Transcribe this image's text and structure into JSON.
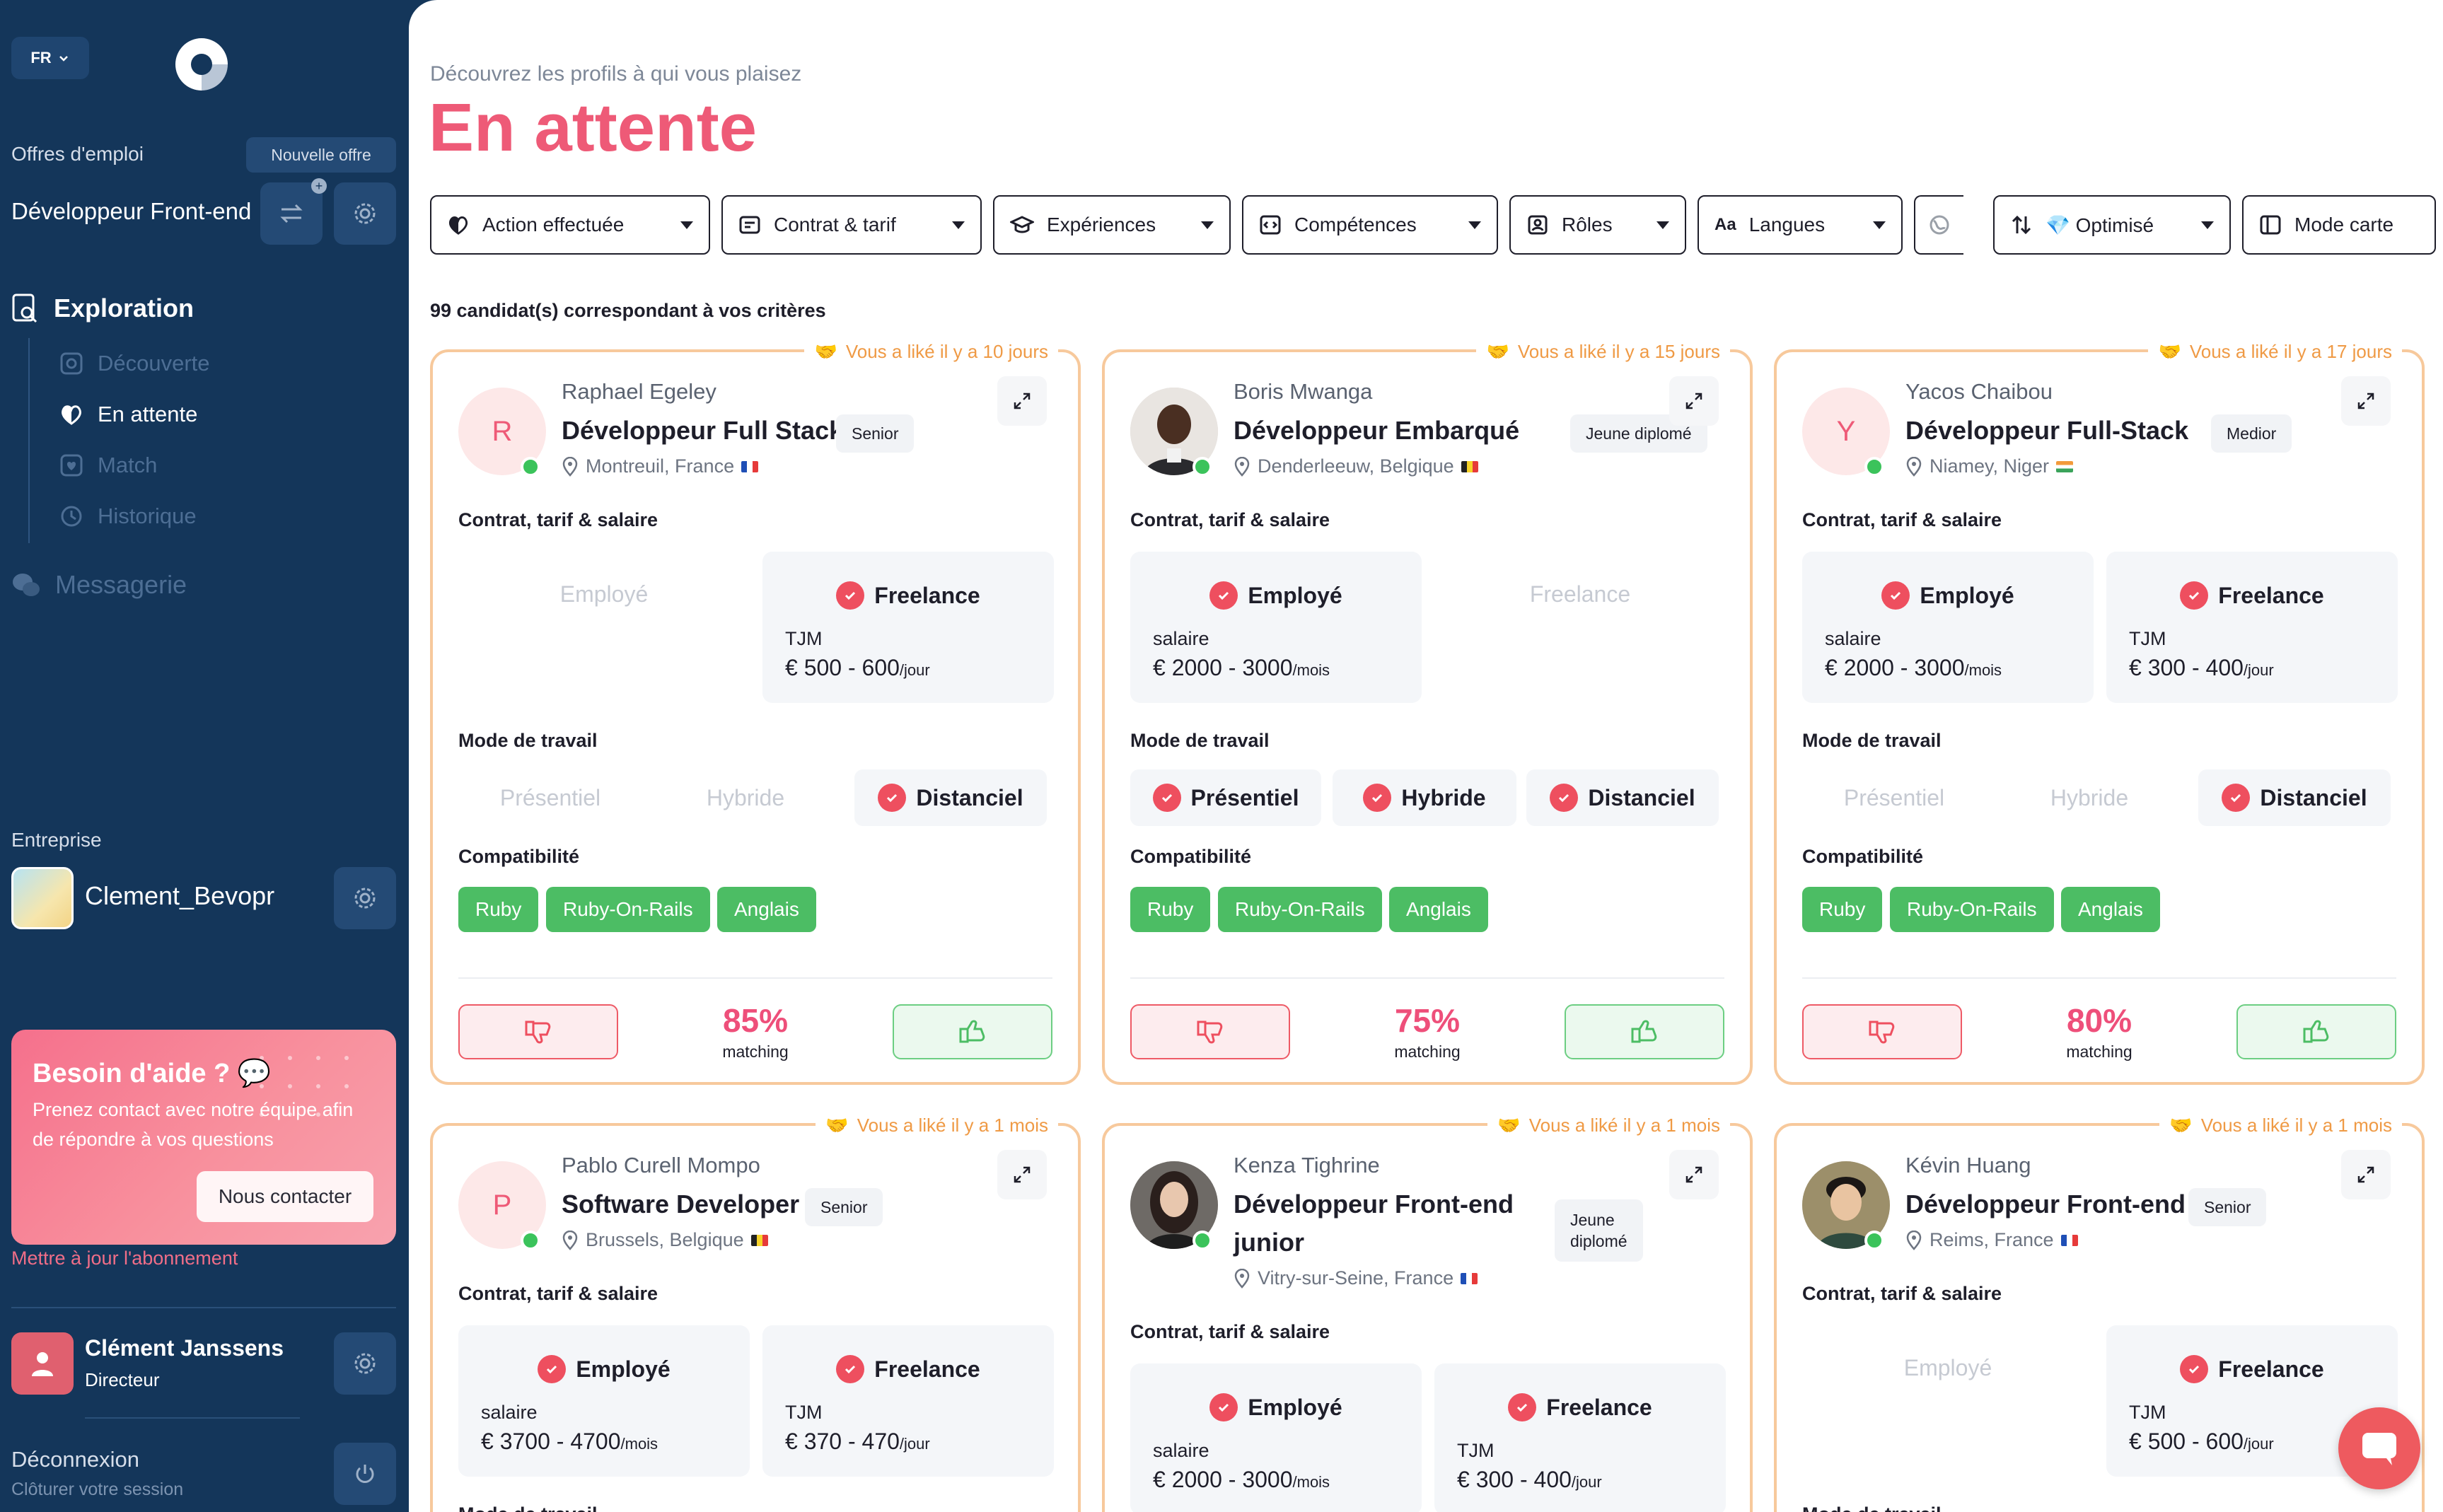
{
  "sidebar": {
    "lang": "FR",
    "job_offers_label": "Offres d'emploi",
    "new_offer": "Nouvelle offre",
    "current_job": "Développeur Front-end",
    "nav": {
      "exploration": "Exploration",
      "decouverte": "Découverte",
      "en_attente": "En attente",
      "match": "Match",
      "historique": "Historique",
      "messagerie": "Messagerie"
    },
    "company_label": "Entreprise",
    "company_name": "Clement_Bevopr",
    "help": {
      "title": "Besoin d'aide ? 💬",
      "text": "Prenez contact avec notre équipe afin de répondre à vos questions",
      "button": "Nous contacter"
    },
    "update_subscription": "Mettre à jour l'abonnement",
    "user": {
      "name": "Clément Janssens",
      "role": "Directeur"
    },
    "logout": {
      "label": "Déconnexion",
      "sub": "Clôturer votre session"
    }
  },
  "main": {
    "subtitle": "Découvrez les profils à qui vous plaisez",
    "title": "En attente",
    "filters": {
      "action": "Action effectuée",
      "contract": "Contrat & tarif",
      "experience": "Expériences",
      "skills": "Compétences",
      "roles": "Rôles",
      "languages": "Langues",
      "sort": "💎 Optimisé",
      "view": "Mode carte"
    },
    "results": "99 candidat(s) correspondant à vos critères",
    "labels": {
      "contract": "Contrat, tarif & salaire",
      "work_mode": "Mode de travail",
      "compat": "Compatibilité",
      "employee": "Employé",
      "freelance": "Freelance",
      "tjm": "TJM",
      "salary": "salaire",
      "onsite": "Présentiel",
      "hybrid": "Hybride",
      "remote": "Distanciel",
      "matching": "matching"
    },
    "cards": [
      {
        "liked": "Vous a liké il y a 10 jours",
        "initial": "R",
        "name": "Raphael Egeley",
        "title": "Développeur Full Stack",
        "level": "Senior",
        "location": "Montreuil, France",
        "freelance_rate": "€ 500 - 600",
        "freelance_unit": "/jour",
        "tags": [
          "Ruby",
          "Ruby-On-Rails",
          "Anglais"
        ],
        "match": "85%"
      },
      {
        "liked": "Vous a liké il y a 15 jours",
        "name": "Boris Mwanga",
        "title": "Développeur Embarqué",
        "level": "Jeune diplomé",
        "location": "Denderleeuw, Belgique",
        "salary": "€ 2000 - 3000",
        "salary_unit": "/mois",
        "tags": [
          "Ruby",
          "Ruby-On-Rails",
          "Anglais"
        ],
        "match": "75%"
      },
      {
        "liked": "Vous a liké il y a 17 jours",
        "initial": "Y",
        "name": "Yacos Chaibou",
        "title": "Développeur Full-Stack",
        "level": "Medior",
        "location": "Niamey, Niger",
        "salary": "€ 2000 - 3000",
        "salary_unit": "/mois",
        "freelance_rate": "€ 300 - 400",
        "freelance_unit": "/jour",
        "tags": [
          "Ruby",
          "Ruby-On-Rails",
          "Anglais"
        ],
        "match": "80%"
      },
      {
        "liked": "Vous a liké il y a 1 mois",
        "initial": "P",
        "name": "Pablo Curell Mompo",
        "title": "Software Developer",
        "level": "Senior",
        "location": "Brussels, Belgique",
        "salary": "€ 3700 - 4700",
        "salary_unit": "/mois",
        "freelance_rate": "€ 370 - 470",
        "freelance_unit": "/jour"
      },
      {
        "liked": "Vous a liké il y a 1 mois",
        "name": "Kenza Tighrine",
        "title_line1": "Développeur Front-end",
        "title_line2": "junior",
        "level_line1": "Jeune",
        "level_line2": "diplomé",
        "location": "Vitry-sur-Seine, France",
        "salary": "€ 2000 - 3000",
        "salary_unit": "/mois",
        "freelance_rate": "€ 300 - 400",
        "freelance_unit": "/jour"
      },
      {
        "liked": "Vous a liké il y a 1 mois",
        "name": "Kévin Huang",
        "title": "Développeur Front-end",
        "level": "Senior",
        "location": "Reims, France",
        "freelance_rate": "€ 500 - 600",
        "freelance_unit": "/jour"
      }
    ]
  },
  "colors": {
    "accent": "#ee5a77",
    "sidebar": "#14365a",
    "liked": "#ef9a45",
    "tag": "#4cbd64"
  }
}
